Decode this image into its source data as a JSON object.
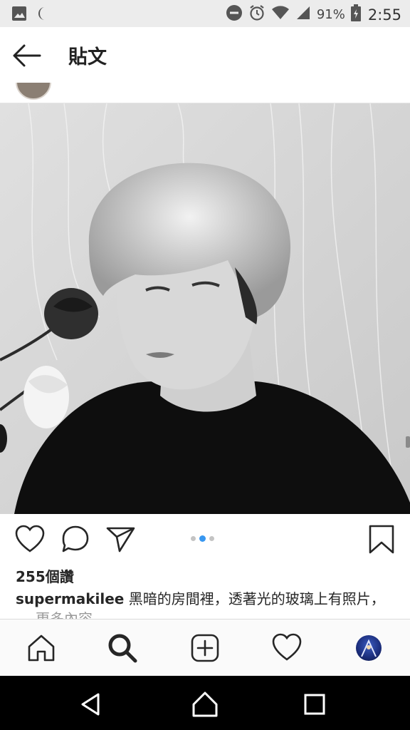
{
  "status_bar": {
    "battery_percent": "91%",
    "time": "2:55",
    "icons": [
      "gallery-icon",
      "moon-icon",
      "dnd-icon",
      "alarm-icon",
      "wifi-icon",
      "signal-icon",
      "battery-icon"
    ]
  },
  "header": {
    "title": "貼文",
    "back_icon": "arrow-left-icon"
  },
  "post": {
    "carousel": {
      "total": 3,
      "active_index": 1
    },
    "likes": "255個讚",
    "username": "supermakilee",
    "caption": "黑暗的房間裡，透著光的玻璃上有照片，",
    "more_label": "更多內容"
  },
  "bottom_nav": [
    "home-icon",
    "search-icon",
    "add-post-icon",
    "heart-icon",
    "profile-avatar"
  ],
  "system_nav": [
    "back-icon",
    "home-icon",
    "recents-icon"
  ],
  "colors": {
    "accent": "#3897f0",
    "status_bar": "#ececec",
    "nav_bg": "#fafafa"
  }
}
